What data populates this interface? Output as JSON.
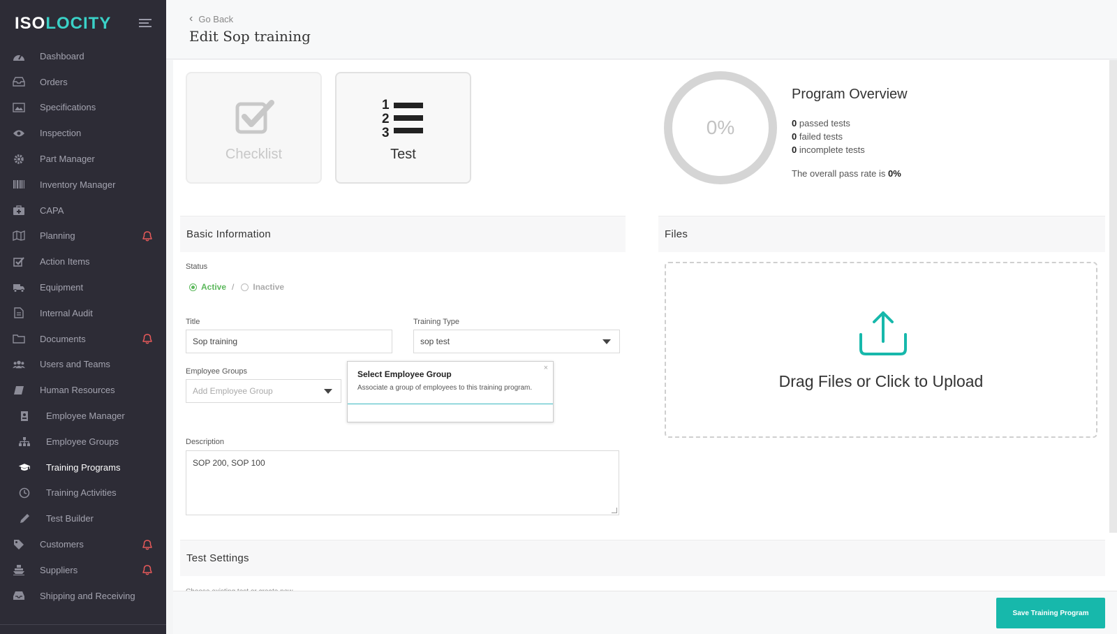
{
  "app": {
    "logo_prefix": "ISO",
    "logo_rest": "LOCITY"
  },
  "sidebar": {
    "items": [
      {
        "label": "Dashboard",
        "icon": "dashboard-icon",
        "sub": false,
        "bell": false,
        "active": false
      },
      {
        "label": "Orders",
        "icon": "inbox-icon",
        "sub": false,
        "bell": false,
        "active": false
      },
      {
        "label": "Specifications",
        "icon": "image-icon",
        "sub": false,
        "bell": false,
        "active": false
      },
      {
        "label": "Inspection",
        "icon": "eye-icon",
        "sub": false,
        "bell": false,
        "active": false
      },
      {
        "label": "Part Manager",
        "icon": "gear-icon",
        "sub": false,
        "bell": false,
        "active": false
      },
      {
        "label": "Inventory Manager",
        "icon": "barcode-icon",
        "sub": false,
        "bell": false,
        "active": false
      },
      {
        "label": "CAPA",
        "icon": "medkit-icon",
        "sub": false,
        "bell": false,
        "active": false
      },
      {
        "label": "Planning",
        "icon": "map-icon",
        "sub": false,
        "bell": true,
        "active": false
      },
      {
        "label": "Action Items",
        "icon": "checkbox-icon",
        "sub": false,
        "bell": false,
        "active": false
      },
      {
        "label": "Equipment",
        "icon": "truck-icon",
        "sub": false,
        "bell": false,
        "active": false
      },
      {
        "label": "Internal Audit",
        "icon": "document-icon",
        "sub": false,
        "bell": false,
        "active": false
      },
      {
        "label": "Documents",
        "icon": "folder-icon",
        "sub": false,
        "bell": true,
        "active": false
      },
      {
        "label": "Users and Teams",
        "icon": "users-icon",
        "sub": false,
        "bell": false,
        "active": false
      },
      {
        "label": "Human Resources",
        "icon": "book-icon",
        "sub": false,
        "bell": false,
        "active": false
      },
      {
        "label": "Employee Manager",
        "icon": "id-badge-icon",
        "sub": true,
        "bell": false,
        "active": false
      },
      {
        "label": "Employee Groups",
        "icon": "sitemap-icon",
        "sub": true,
        "bell": false,
        "active": false
      },
      {
        "label": "Training Programs",
        "icon": "graduation-cap-icon",
        "sub": true,
        "bell": false,
        "active": true
      },
      {
        "label": "Training Activities",
        "icon": "clock-icon",
        "sub": true,
        "bell": false,
        "active": false
      },
      {
        "label": "Test Builder",
        "icon": "pencil-icon",
        "sub": true,
        "bell": false,
        "active": false
      },
      {
        "label": "Customers",
        "icon": "tag-icon",
        "sub": false,
        "bell": true,
        "active": false
      },
      {
        "label": "Suppliers",
        "icon": "ship-icon",
        "sub": false,
        "bell": true,
        "active": false
      },
      {
        "label": "Shipping and Receiving",
        "icon": "tray-icon",
        "sub": false,
        "bell": false,
        "active": false
      }
    ]
  },
  "header": {
    "go_back": "Go Back",
    "title": "Edit Sop training"
  },
  "tiles": {
    "checklist": "Checklist",
    "test": "Test"
  },
  "overview": {
    "pct": "0%",
    "title": "Program Overview",
    "passed_count": "0",
    "passed_label": "passed tests",
    "failed_count": "0",
    "failed_label": "failed tests",
    "incomplete_count": "0",
    "incomplete_label": "incomplete tests",
    "pass_rate_text": "The overall pass rate is",
    "pass_rate_value": "0%"
  },
  "basic": {
    "section_title": "Basic Information",
    "status_label": "Status",
    "active_label": "Active",
    "sep": "/",
    "inactive_label": "Inactive",
    "title_label": "Title",
    "title_value": "Sop training",
    "training_type_label": "Training Type",
    "training_type_value": "sop test",
    "employee_groups_label": "Employee Groups",
    "employee_groups_placeholder": "Add Employee Group",
    "description_label": "Description",
    "description_value": "SOP 200, SOP 100"
  },
  "popover": {
    "title": "Select Employee Group",
    "desc": "Associate a group of employees to this training program.",
    "close": "×"
  },
  "files": {
    "section_title": "Files",
    "dropzone_text": "Drag Files or Click to Upload"
  },
  "test_settings": {
    "section_title": "Test Settings",
    "cut_text": "Choose existing test or create new"
  },
  "footer": {
    "save_label": "Save Training Program"
  },
  "colors": {
    "accent": "#17b8ab",
    "sidebar_bg": "#2d2c36",
    "active_green": "#5cb85c",
    "bell_red": "#e85a5a",
    "logo_teal": "#3ad1c7"
  }
}
